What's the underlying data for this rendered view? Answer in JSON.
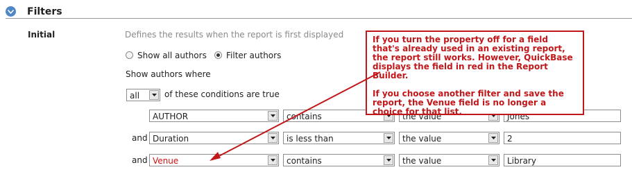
{
  "header": {
    "title": "Filters",
    "toggle_icon": "chevron-down-icon",
    "accent": "#4f86c6"
  },
  "initial": {
    "label": "Initial",
    "description": "Defines the results when the report is first displayed"
  },
  "radios": [
    {
      "label": "Show all authors",
      "selected": false
    },
    {
      "label": "Filter authors",
      "selected": true
    }
  ],
  "show_where_label": "Show authors where",
  "match": {
    "value": "all",
    "suffix": "of these conditions are true"
  },
  "conditions": [
    {
      "conjunction": "",
      "field": "AUTHOR",
      "operator": "contains",
      "value_type": "the value",
      "value": "Jones"
    },
    {
      "conjunction": "and",
      "field": "Duration",
      "operator": "is less than",
      "value_type": "the value",
      "value": "2"
    },
    {
      "conjunction": "and",
      "field": "Venue",
      "operator": "contains",
      "value_type": "the value",
      "value": "Library",
      "field_color": "#d01010"
    }
  ],
  "callout": {
    "paragraph1": "If you turn the property off for a field that's already used in an existing report, the report still works. However, QuickBase displays the field in red in the Report Builder.",
    "paragraph2": "If you choose another filter and save the report, the Venue field is no longer a choice for that list.",
    "color": "#c0181a"
  }
}
